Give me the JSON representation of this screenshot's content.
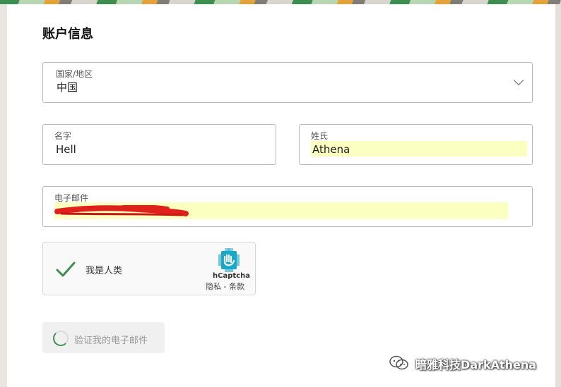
{
  "form": {
    "section_title": "账户信息",
    "country": {
      "label": "国家/地区",
      "value": "中国"
    },
    "first_name": {
      "label": "名字",
      "value": "Hell"
    },
    "last_name": {
      "label": "姓氏",
      "value": "Athena"
    },
    "email": {
      "label": "电子邮件",
      "value": ""
    }
  },
  "captcha": {
    "label": "我是人类",
    "brand": "hCaptcha",
    "links": "隐私 - 条款",
    "checked": true
  },
  "verify_button": {
    "label": "验证我的电子邮件",
    "state": "loading"
  },
  "watermark": {
    "text": "暗雅科技DarkAthena"
  },
  "colors": {
    "accent_green": "#3e8e52",
    "autofill": "#fbffc0",
    "redaction": "#e0201a",
    "hcaptcha_blue": "#1aa7c8"
  },
  "icons": [
    "chevron-down-icon",
    "checkmark-icon",
    "hcaptcha-logo-icon",
    "loading-spinner-icon",
    "wechat-icon"
  ]
}
